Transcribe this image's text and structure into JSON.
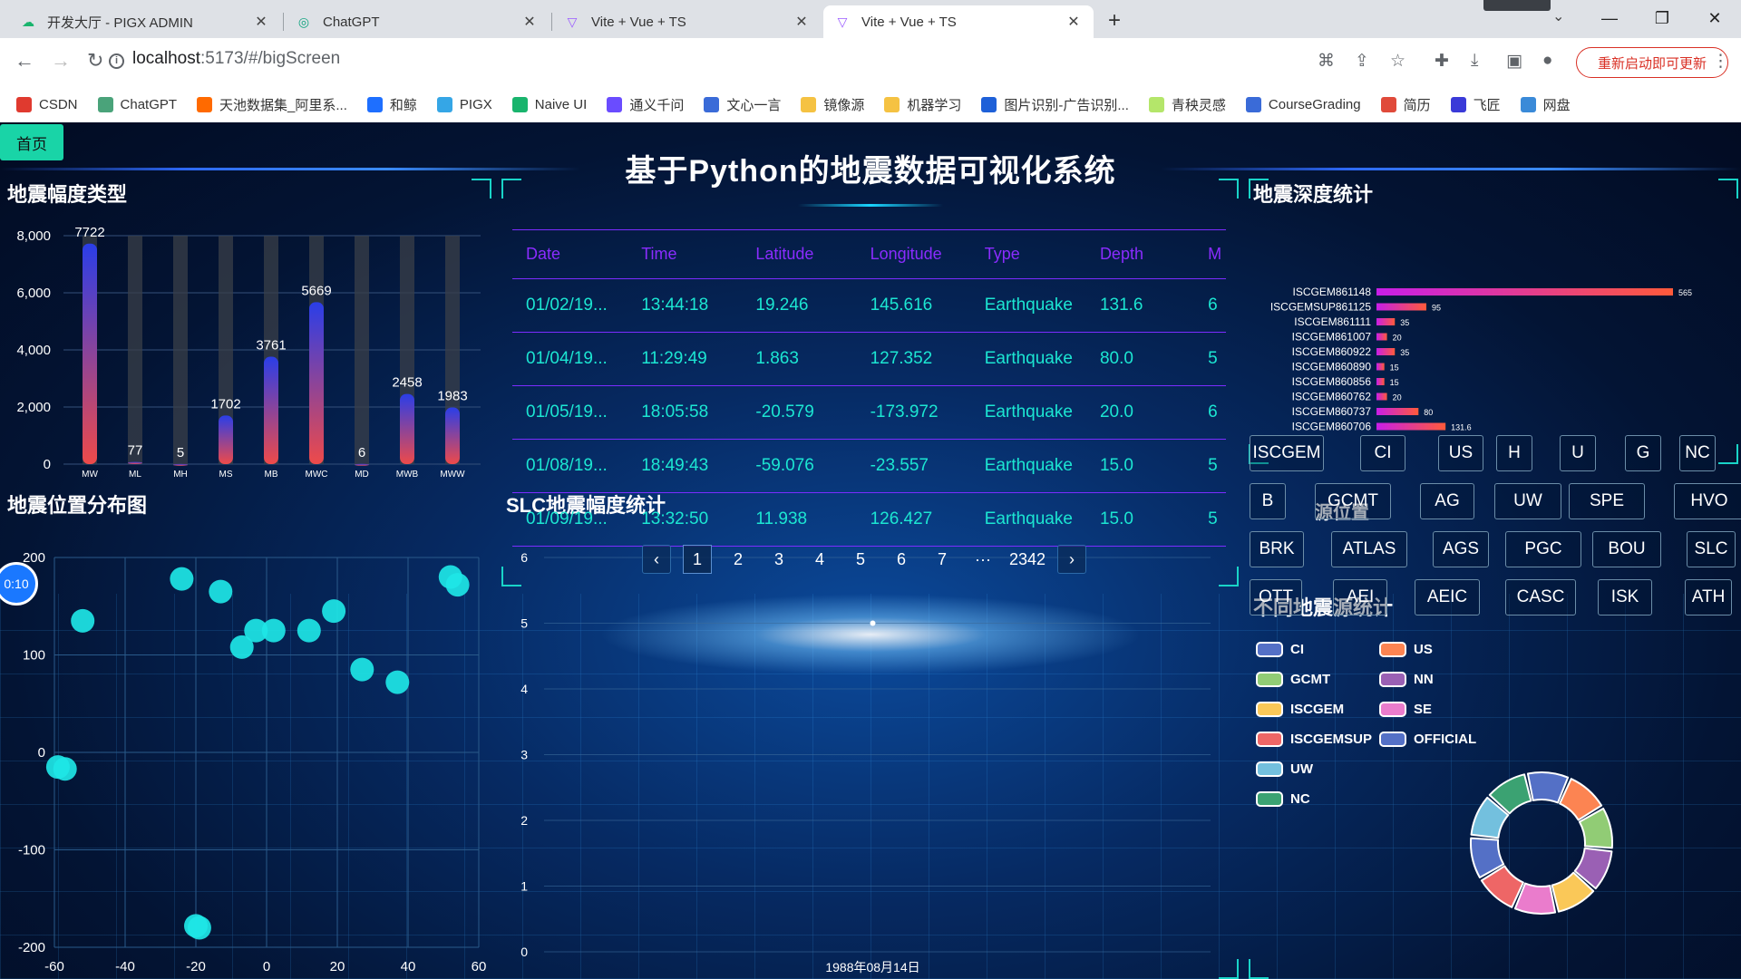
{
  "browser": {
    "tabs": [
      {
        "title": "开发大厅 - PIGX ADMIN"
      },
      {
        "title": "ChatGPT"
      },
      {
        "title": "Vite + Vue + TS"
      },
      {
        "title": "Vite + Vue + TS"
      }
    ],
    "url_host": "localhost",
    "url_path": ":5173/#/bigScreen",
    "update_button": "重新启动即可更新",
    "bookmarks": [
      "CSDN",
      "ChatGPT",
      "天池数据集_阿里系...",
      "和鲸",
      "PIGX",
      "Naive UI",
      "通义千问",
      "文心一言",
      "镜像源",
      "机器学习",
      "图片识别-广告识别...",
      "青秧灵感",
      "CourseGrading",
      "简历",
      "飞匠",
      "网盘"
    ]
  },
  "dashboard": {
    "home_button": "首页",
    "title": "基于Python的地震数据可视化系统",
    "timer": "0:10",
    "panels": {
      "magnitude_type": "地震幅度类型",
      "location_dist": "地震位置分布图",
      "slc_magnitude": "SLC地震幅度统计",
      "depth_stats": "地震深度统计",
      "source_location": "源位置",
      "source_stats": "不同地震源统计"
    }
  },
  "table": {
    "headers": [
      "Date",
      "Time",
      "Latitude",
      "Longitude",
      "Type",
      "Depth",
      "M"
    ],
    "rows": [
      [
        "01/02/19...",
        "13:44:18",
        "19.246",
        "145.616",
        "Earthquake",
        "131.6",
        "6"
      ],
      [
        "01/04/19...",
        "11:29:49",
        "1.863",
        "127.352",
        "Earthquake",
        "80.0",
        "5"
      ],
      [
        "01/05/19...",
        "18:05:58",
        "-20.579",
        "-173.972",
        "Earthquake",
        "20.0",
        "6"
      ],
      [
        "01/08/19...",
        "18:49:43",
        "-59.076",
        "-23.557",
        "Earthquake",
        "15.0",
        "5"
      ],
      [
        "01/09/19...",
        "13:32:50",
        "11.938",
        "126.427",
        "Earthquake",
        "15.0",
        "5"
      ]
    ],
    "pager": {
      "prev": "‹",
      "pages": [
        "1",
        "2",
        "3",
        "4",
        "5",
        "6",
        "7",
        "···",
        "2342"
      ],
      "next": "›",
      "current": "1"
    }
  },
  "sources": {
    "buttons": [
      "ISCGEM",
      "CI",
      "US",
      "H",
      "U",
      "G",
      "NC",
      "B",
      "GCMT",
      "AG",
      "UW",
      "SPE",
      "HVO",
      "BRK",
      "ATLAS",
      "AGS",
      "PGC",
      "BOU",
      "SLC",
      "OTT",
      "AEI",
      "AEIC",
      "CASC",
      "ISK",
      "ATH"
    ]
  },
  "chart_data": [
    {
      "type": "bar",
      "name": "magnitude_type",
      "categories": [
        "MW",
        "ML",
        "MH",
        "MS",
        "MB",
        "MWC",
        "MD",
        "MWB",
        "MWW"
      ],
      "values": [
        7722,
        77,
        5,
        1702,
        3761,
        5669,
        6,
        2458,
        1983
      ],
      "ylim": [
        0,
        8000
      ],
      "yticks": [
        "0",
        "2,000",
        "4,000",
        "6,000",
        "8,000"
      ],
      "colors": {
        "top": "#2a3ee8",
        "bottom": "#ee4a4a",
        "background": "#3a3f48"
      }
    },
    {
      "type": "scatter",
      "name": "location_dist",
      "points": [
        [
          -59,
          -15
        ],
        [
          -57,
          -17
        ],
        [
          -52,
          135
        ],
        [
          -24,
          178
        ],
        [
          -20,
          -178
        ],
        [
          -19,
          -180
        ],
        [
          -13,
          165
        ],
        [
          -7,
          108
        ],
        [
          -3,
          125
        ],
        [
          2,
          125
        ],
        [
          12,
          125
        ],
        [
          19,
          145
        ],
        [
          27,
          85
        ],
        [
          37,
          72
        ],
        [
          52,
          180
        ],
        [
          54,
          172
        ]
      ],
      "xlim": [
        -60,
        60
      ],
      "ylim": [
        -200,
        200
      ],
      "xticks": [
        "-60",
        "-40",
        "-20",
        "0",
        "20",
        "40",
        "60"
      ],
      "yticks": [
        "-200",
        "-100",
        "0",
        "100",
        "200"
      ],
      "color": "#1ee6e6"
    },
    {
      "type": "line",
      "name": "slc_magnitude",
      "x": [
        "1988年08月14日"
      ],
      "values": [
        5.0
      ],
      "ylim": [
        0,
        6
      ],
      "yticks": [
        "0",
        "1",
        "2",
        "3",
        "4",
        "5",
        "6"
      ]
    },
    {
      "type": "bar",
      "name": "depth_stats",
      "orientation": "horizontal",
      "categories": [
        "ISCGEM861148",
        "ISCGEMSUP861125",
        "ISCGEM861111",
        "ISCGEM861007",
        "ISCGEM860922",
        "ISCGEM860890",
        "ISCGEM860856",
        "ISCGEM860762",
        "ISCGEM860737",
        "ISCGEM860706"
      ],
      "values": [
        565,
        95,
        35,
        20,
        35,
        15,
        15,
        20,
        80,
        131.6
      ],
      "labels": [
        "565",
        "95",
        "35",
        "20",
        "35",
        "15",
        "15",
        "20",
        "80",
        "131.6"
      ],
      "xlim": [
        0,
        565
      ],
      "colors": {
        "start": "#c81ee8",
        "end": "#ff5a3a"
      }
    },
    {
      "type": "pie",
      "name": "source_stats",
      "slices": [
        {
          "name": "CI",
          "value": 1,
          "color": "#5470c6"
        },
        {
          "name": "US",
          "value": 1,
          "color": "#fc8452"
        },
        {
          "name": "GCMT",
          "value": 1,
          "color": "#91cc75"
        },
        {
          "name": "NN",
          "value": 1,
          "color": "#9a60b4"
        },
        {
          "name": "ISCGEM",
          "value": 1,
          "color": "#fac858"
        },
        {
          "name": "SE",
          "value": 1,
          "color": "#ea7ccc"
        },
        {
          "name": "ISCGEMSUP",
          "value": 1,
          "color": "#ee6666"
        },
        {
          "name": "OFFICIAL",
          "value": 1,
          "color": "#5470c6"
        },
        {
          "name": "UW",
          "value": 1,
          "color": "#73c0de"
        },
        {
          "name": "NC",
          "value": 1,
          "color": "#3ba272"
        }
      ]
    }
  ]
}
